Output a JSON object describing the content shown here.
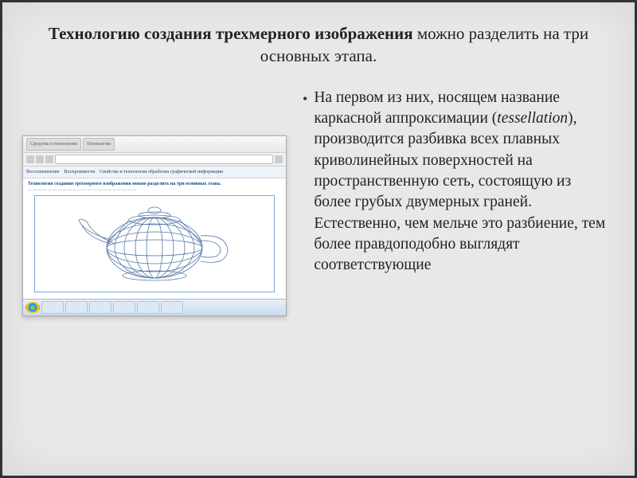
{
  "title": {
    "bold": "Технологию создания трехмерного изображения",
    "rest": " можно разделить на три основных этапа."
  },
  "bullet": {
    "text_before_em": "На первом из них, носящем название каркасной аппроксимации (",
    "em": "tessellation",
    "text_after_em": "), производится разбивка всех плавных криволинейных поверхностей на пространственную сеть, состоящую из более грубых двумерных граней. Естественно, чем мельче это разбиение, тем более правдоподобно выглядят соответствующие"
  },
  "screenshot": {
    "tabs": [
      "Средства и технологии",
      "Технологии"
    ],
    "toolbar_items": [
      "Восстановление",
      "Воспроизвести",
      "Свойства и технологии обработки графической информации"
    ],
    "page_heading": "Технология создания трехмерного изображения можно разделить на три основных этапа."
  }
}
